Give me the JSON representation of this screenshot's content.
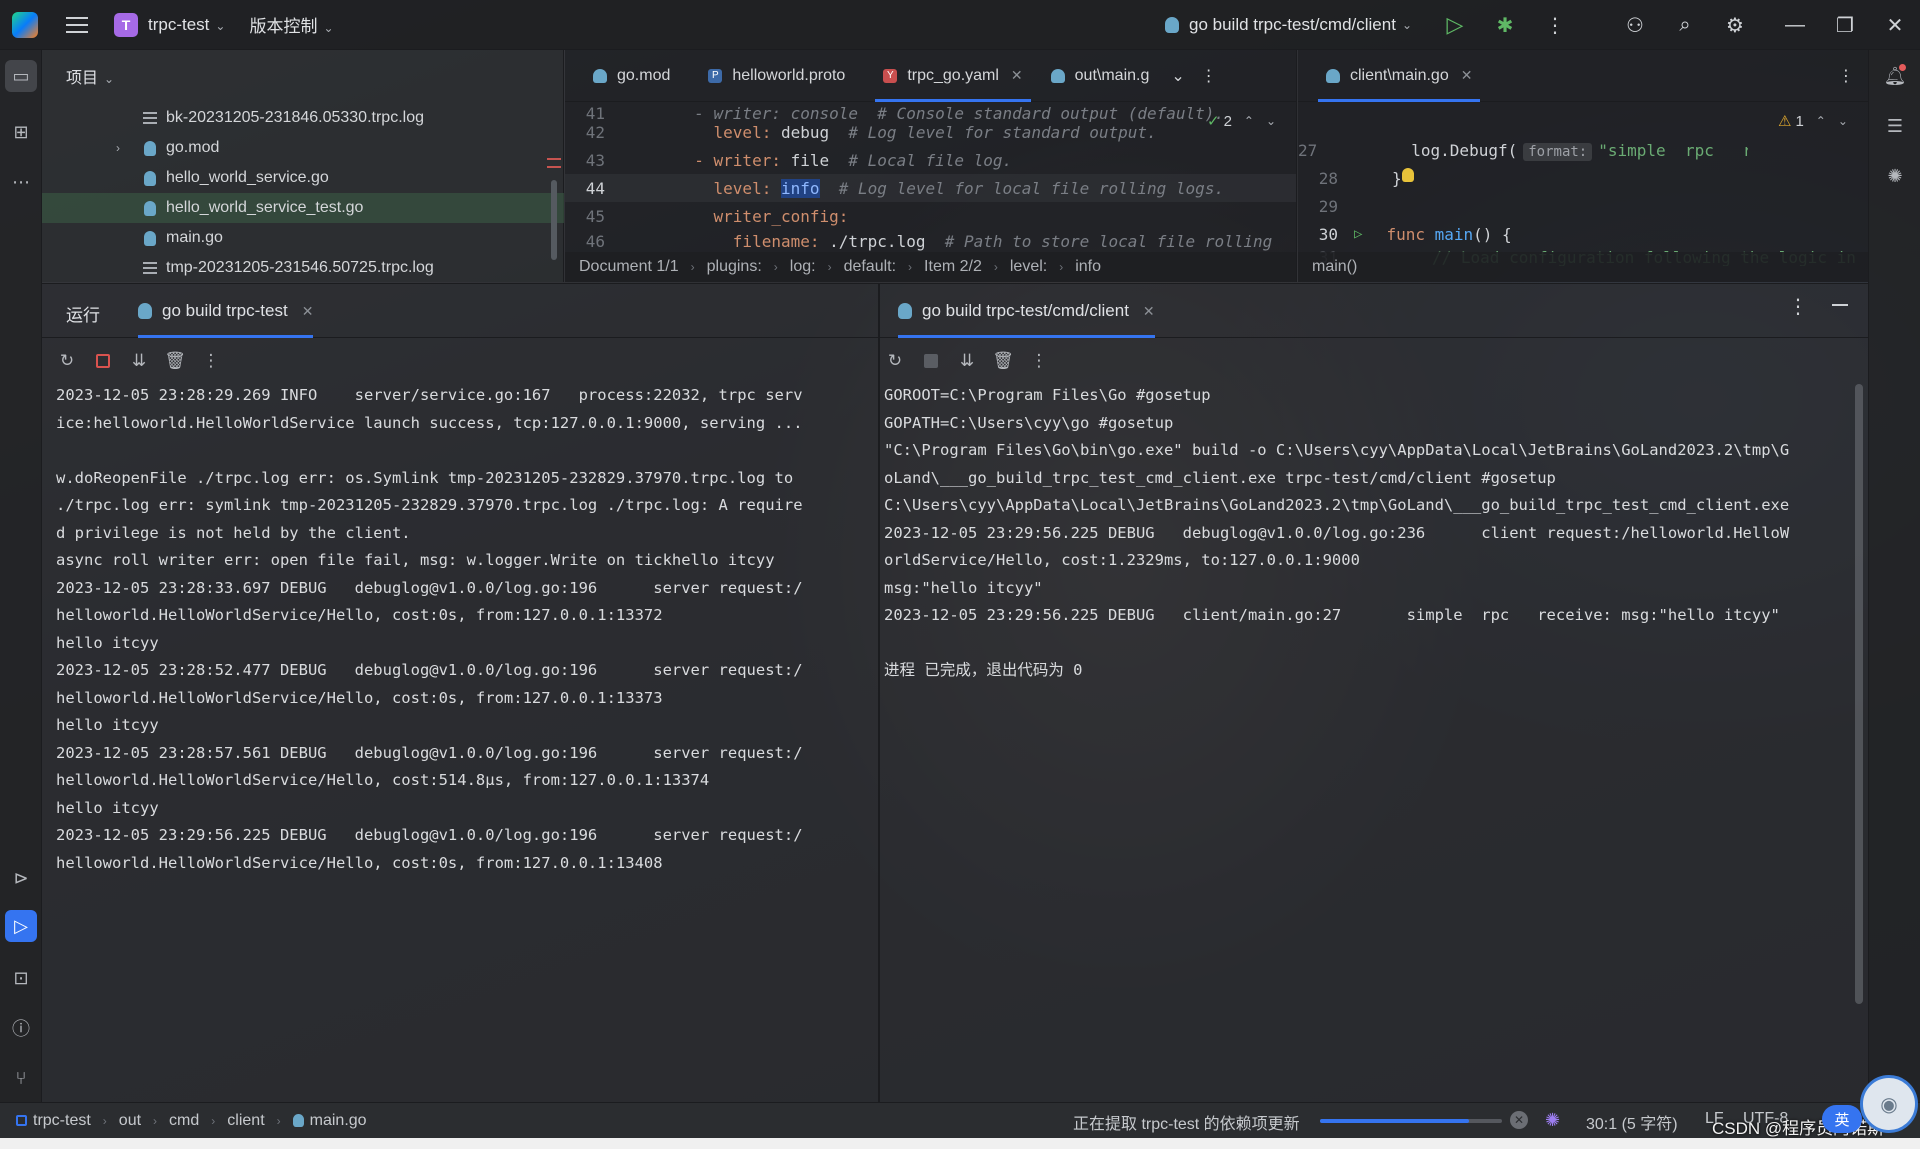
{
  "titlebar": {
    "project_letter": "T",
    "project_name": "trpc-test",
    "vcs_label": "版本控制",
    "run_config": "go build trpc-test/cmd/client"
  },
  "project_panel": {
    "header": "项目",
    "items": [
      {
        "name": "bk-20231205-231846.05330.trpc.log",
        "icon": "log-file-icon"
      },
      {
        "name": "go.mod",
        "icon": "go-module-icon",
        "collapsed": true
      },
      {
        "name": "hello_world_service.go",
        "icon": "go-file-icon"
      },
      {
        "name": "hello_world_service_test.go",
        "icon": "go-test-file-icon"
      },
      {
        "name": "main.go",
        "icon": "go-file-icon"
      },
      {
        "name": "tmp-20231205-231546.50725.trpc.log",
        "icon": "log-file-icon"
      }
    ]
  },
  "editor_left": {
    "tabs": [
      {
        "label": "go.mod",
        "icon": "go-module-icon"
      },
      {
        "label": "helloworld.proto",
        "icon": "proto-file-icon"
      },
      {
        "label": "trpc_go.yaml",
        "icon": "yaml-file-icon",
        "active": true
      },
      {
        "label": "out\\main.g",
        "icon": "go-file-icon"
      }
    ],
    "inspection_count": "2",
    "lines": [
      {
        "n": "41",
        "text": "  - writer: console  # Console standard output (default)."
      },
      {
        "n": "42",
        "key": "    level:",
        "val": " debug",
        "comment": "  # Log level for standard output."
      },
      {
        "n": "43",
        "key": "  - writer:",
        "val": " file",
        "comment": "  # Local file log."
      },
      {
        "n": "44",
        "key": "    level:",
        "val": "info",
        "comment": "  # Log level for local file rolling logs."
      },
      {
        "n": "45",
        "key": "    writer_config:",
        "val": "",
        "comment": ""
      },
      {
        "n": "46",
        "key": "      filename:",
        "val": " ./trpc.log",
        "comment": "  # Path to store local file rolling"
      }
    ],
    "breadcrumbs": [
      "Document 1/1",
      "plugins:",
      "log:",
      "default:",
      "Item 2/2",
      "level:",
      "info"
    ]
  },
  "editor_right": {
    "tab": "client\\main.go",
    "warning_count": "1",
    "line27_n": "27",
    "line27_fn": "log.Debugf(",
    "line27_hint": "format:",
    "line27_str": "\"simple  rpc   r",
    "line28_n": "28",
    "line28_text": "}",
    "line29_n": "29",
    "line30_n": "30",
    "line30_kw": "func",
    "line30_fn": "main",
    "line30_rest": "() {",
    "line31_n": "31",
    "line31_comment": "// Load configuration following the logic in",
    "breadcrumb": "main()"
  },
  "run_panel": {
    "title": "运行",
    "left_tab": "go build trpc-test",
    "right_tab": "go build trpc-test/cmd/client",
    "left_output": "2023-12-05 23:28:29.269 INFO    server/service.go:167   process:22032, trpc serv\nice:helloworld.HelloWorldService launch success, tcp:127.0.0.1:9000, serving ...\n\nw.doReopenFile ./trpc.log err: os.Symlink tmp-20231205-232829.37970.trpc.log to\n./trpc.log err: symlink tmp-20231205-232829.37970.trpc.log ./trpc.log: A require\nd privilege is not held by the client.\nasync roll writer err: open file fail, msg: w.logger.Write on tickhello itcyy\n2023-12-05 23:28:33.697 DEBUG   debuglog@v1.0.0/log.go:196      server request:/\nhelloworld.HelloWorldService/Hello, cost:0s, from:127.0.0.1:13372\nhello itcyy\n2023-12-05 23:28:52.477 DEBUG   debuglog@v1.0.0/log.go:196      server request:/\nhelloworld.HelloWorldService/Hello, cost:0s, from:127.0.0.1:13373\nhello itcyy\n2023-12-05 23:28:57.561 DEBUG   debuglog@v1.0.0/log.go:196      server request:/\nhelloworld.HelloWorldService/Hello, cost:514.8µs, from:127.0.0.1:13374\nhello itcyy\n2023-12-05 23:29:56.225 DEBUG   debuglog@v1.0.0/log.go:196      server request:/\nhelloworld.HelloWorldService/Hello, cost:0s, from:127.0.0.1:13408",
    "right_output": "GOROOT=C:\\Program Files\\Go #gosetup\nGOPATH=C:\\Users\\cyy\\go #gosetup\n\"C:\\Program Files\\Go\\bin\\go.exe\" build -o C:\\Users\\cyy\\AppData\\Local\\JetBrains\\GoLand2023.2\\tmp\\G\noLand\\___go_build_trpc_test_cmd_client.exe trpc-test/cmd/client #gosetup\nC:\\Users\\cyy\\AppData\\Local\\JetBrains\\GoLand2023.2\\tmp\\GoLand\\___go_build_trpc_test_cmd_client.exe\n2023-12-05 23:29:56.225 DEBUG   debuglog@v1.0.0/log.go:236      client request:/helloworld.HelloW\norldService/Hello, cost:1.2329ms, to:127.0.0.1:9000\nmsg:\"hello itcyy\"\n2023-12-05 23:29:56.225 DEBUG   client/main.go:27       simple  rpc   receive: msg:\"hello itcyy\"\n\n进程 已完成，退出代码为 0"
  },
  "statusbar": {
    "breadcrumbs": [
      "trpc-test",
      "out",
      "cmd",
      "client",
      "main.go"
    ],
    "task": "正在提取 trpc-test 的依赖项更新",
    "progress": 0.82,
    "position": "30:1 (5 字符)",
    "line_sep": "LF",
    "encoding": "UTF-8"
  },
  "overlay": {
    "watermark": "CSDN @程序员阿诺斯",
    "ime": "英"
  },
  "colors": {
    "accent": "#3574f0",
    "run_green": "#5fb865",
    "stop_red": "#d9534f"
  }
}
